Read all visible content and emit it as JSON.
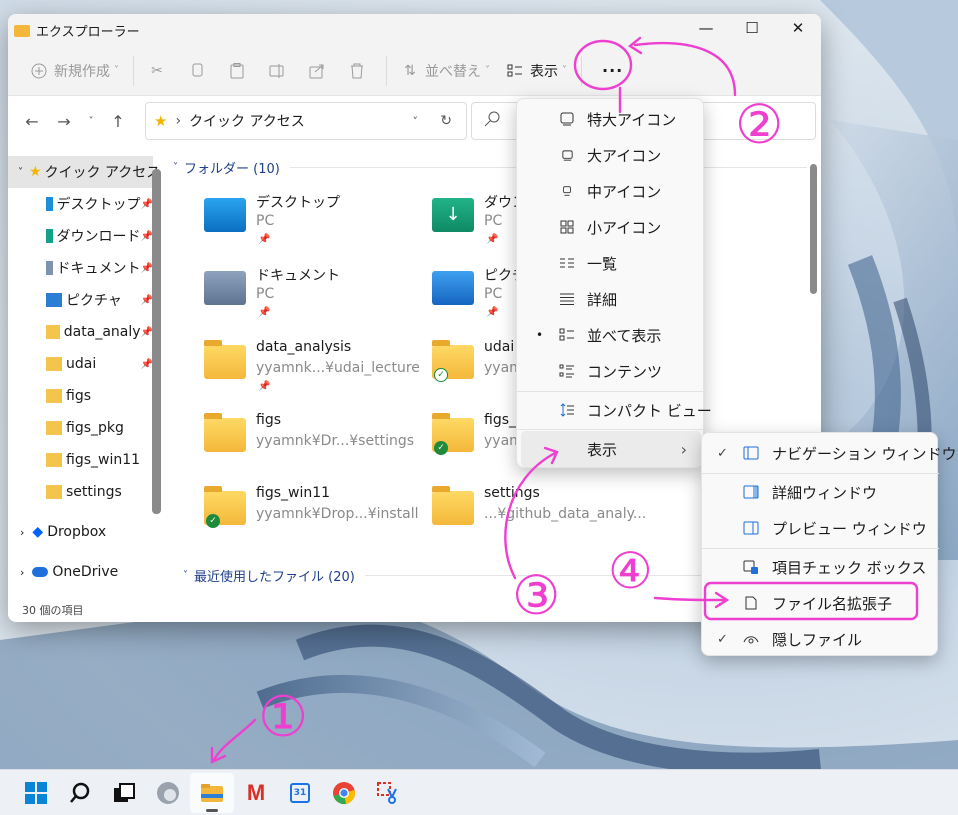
{
  "window": {
    "title": "エクスプローラー",
    "min": "—",
    "max": "☐",
    "close": "✕"
  },
  "toolbar": {
    "new": "新規作成",
    "sort": "並べ替え",
    "view": "表示",
    "more": "···"
  },
  "address": {
    "path_label": "クイック アクセス",
    "separator": "›"
  },
  "sidebar": {
    "quick_access": "クイック アクセス",
    "items": [
      "デスクトップ",
      "ダウンロード",
      "ドキュメント",
      "ピクチャ",
      "data_analy",
      "udai",
      "figs",
      "figs_pkg",
      "figs_win11",
      "settings"
    ],
    "dropbox": "Dropbox",
    "onedrive": "OneDrive"
  },
  "status": "30 個の項目",
  "content": {
    "group_folders": "フォルダー (10)",
    "group_recent": "最近使用したファイル (20)",
    "tiles": [
      {
        "name": "デスクトップ",
        "sub": "PC"
      },
      {
        "name": "ダウン",
        "sub": "PC"
      },
      {
        "name": "ドキュメント",
        "sub": "PC"
      },
      {
        "name": "ピクチ",
        "sub": "PC"
      },
      {
        "name": "data_analysis",
        "sub": "yyamnk...¥udai_lecture"
      },
      {
        "name": "udai",
        "sub": "yyam"
      },
      {
        "name": "figs",
        "sub": "yyamnk¥Dr...¥settings"
      },
      {
        "name": "figs_p",
        "sub": "yyam"
      },
      {
        "name": "figs_win11",
        "sub": "yyamnk¥Drop...¥install"
      },
      {
        "name": "settings",
        "sub": "...¥github_data_analy..."
      }
    ]
  },
  "view_menu": {
    "items": [
      "特大アイコン",
      "大アイコン",
      "中アイコン",
      "小アイコン",
      "一覧",
      "詳細",
      "並べて表示",
      "コンテンツ",
      "コンパクト ビュー",
      "表示"
    ],
    "selected_bullet": "•",
    "submenu_arrow": "›"
  },
  "show_menu": {
    "items": [
      "ナビゲーション ウィンドウ",
      "詳細ウィンドウ",
      "プレビュー ウィンドウ",
      "項目チェック ボックス",
      "ファイル名拡張子",
      "隠しファイル"
    ],
    "check": "✓"
  },
  "annotations": {
    "n1": "①",
    "n2": "②",
    "n3": "③",
    "n4": "④"
  },
  "taskbar": {
    "gmail_letter": "M",
    "calendar_day": "31"
  },
  "colors": {
    "accent": "#1e3f8a",
    "pink": "#ee3fd0",
    "folder": "#f3b83b"
  }
}
